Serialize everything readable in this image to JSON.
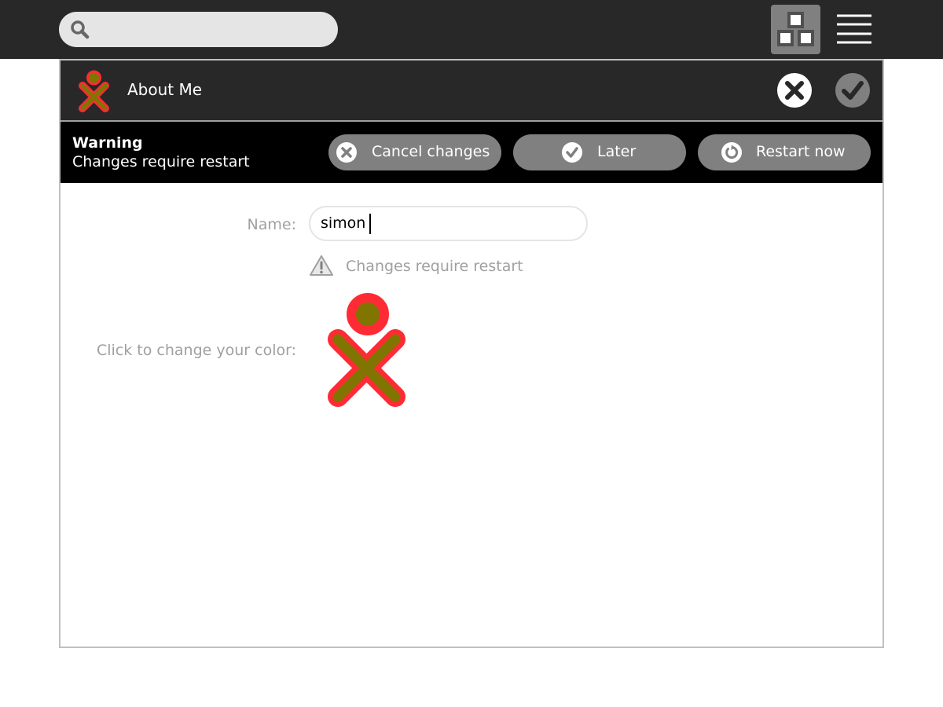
{
  "toolbar": {
    "search_placeholder": "",
    "search_icon": "search-icon",
    "view_icon": "neighborhood-view-icon",
    "menu_icon": "hamburger-menu-icon"
  },
  "dialog": {
    "title": "About Me",
    "header_icon": "xo-buddy-icon",
    "cancel_icon": "dialog-cancel-icon",
    "ok_icon": "dialog-ok-icon"
  },
  "alert": {
    "title": "Warning",
    "message": "Changes require restart",
    "buttons": [
      {
        "label": "Cancel changes",
        "icon": "cancel-circle-icon"
      },
      {
        "label": "Later",
        "icon": "check-circle-icon"
      },
      {
        "label": "Restart now",
        "icon": "restart-icon"
      }
    ]
  },
  "form": {
    "name_label": "Name:",
    "name_value": "simon",
    "restart_note": "Changes require restart",
    "color_label": "Click to change your color:"
  },
  "colors": {
    "toolbar_bg": "#282828",
    "alert_bg": "#000000",
    "button_gray": "#808080",
    "xo_stroke": "#ff2b34",
    "xo_fill": "#807500"
  }
}
